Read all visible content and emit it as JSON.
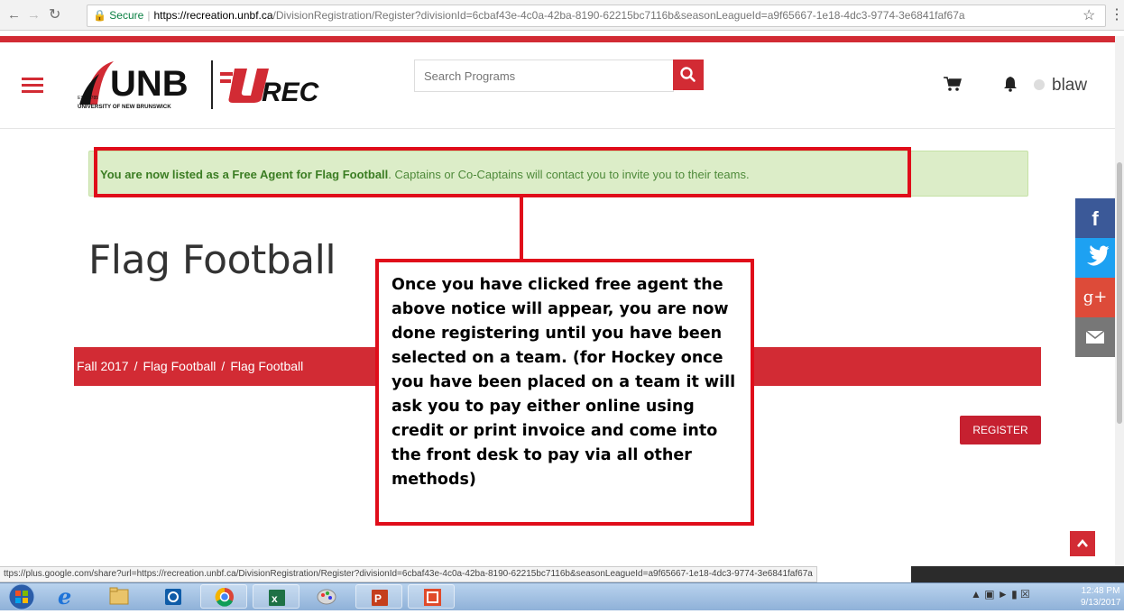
{
  "browser": {
    "secure_label": "Secure",
    "url_host": "https://recreation.unbf.ca",
    "url_path": "/DivisionRegistration/Register?divisionId=6cbaf43e-4c0a-42ba-8190-62215bc7116b&seasonLeagueId=a9f65667-1e18-4dc3-9774-3e6841faf67a"
  },
  "header": {
    "logo_unb": "UNB",
    "logo_est": "EST. 1785",
    "logo_university": "UNIVERSITY OF NEW BRUNSWICK",
    "logo_urec": "REC",
    "search_placeholder": "Search Programs",
    "username": "blaw"
  },
  "alert": {
    "bold": "You are now listed as a Free Agent for Flag Football",
    "rest": ". Captains or Co-Captains will contact you to invite you to their teams."
  },
  "page_title": "Flag Football",
  "breadcrumb": {
    "items": [
      "Fall 2017",
      "Flag Football",
      "Flag Football"
    ],
    "separator": "/"
  },
  "register_label": "REGISTER",
  "callout_text": "Once you have clicked free agent the above notice will appear, you are now done registering until you have been selected on a team. (for Hockey once you have been placed on a team it will ask you to pay either online using credit or print invoice and come into the front desk to pay via all other methods)",
  "social": {
    "facebook_glyph": "f",
    "gplus_glyph": "g+"
  },
  "status_bar_url": "ttps://plus.google.com/share?url=https://recreation.unbf.ca/DivisionRegistration/Register?divisionId=6cbaf43e-4c0a-42ba-8190-62215bc7116b&seasonLeagueId=a9f65667-1e18-4dc3-9774-3e6841faf67a",
  "taskbar": {
    "clock_time": "12:48 PM",
    "clock_date": "9/13/2017"
  },
  "colors": {
    "brand_red": "#d22b34",
    "annotation_red": "#e00d1a",
    "alert_bg": "#dcedc8",
    "alert_text": "#4e8a3a"
  }
}
